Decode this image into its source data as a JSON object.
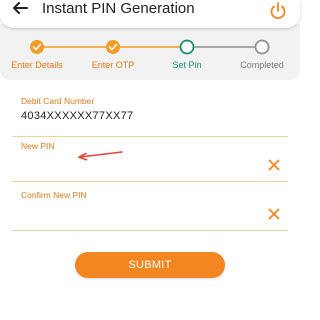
{
  "header": {
    "title": "Instant PIN Generation",
    "back_icon": "arrow-left-icon",
    "power_icon": "power-icon"
  },
  "colors": {
    "accent": "#f28621",
    "done": "#f39c28",
    "current": "#1e8a74",
    "pending": "#8f8f8f",
    "label_orange": "#e07a1c",
    "field_line": "#e7d8a3"
  },
  "stepper": {
    "steps": [
      {
        "label": "Enter Details",
        "status": "done"
      },
      {
        "label": "Enter OTP",
        "status": "done"
      },
      {
        "label": "Set Pin",
        "status": "current"
      },
      {
        "label": "Completed",
        "status": "pending"
      }
    ]
  },
  "form": {
    "debit_card": {
      "label": "Debit Card Number",
      "value": "4034XXXXXX77XX77"
    },
    "new_pin": {
      "label": "New PIN",
      "value": ""
    },
    "confirm_pin": {
      "label": "Confirm New PIN",
      "value": ""
    }
  },
  "submit": {
    "label": "SUBMIT"
  }
}
